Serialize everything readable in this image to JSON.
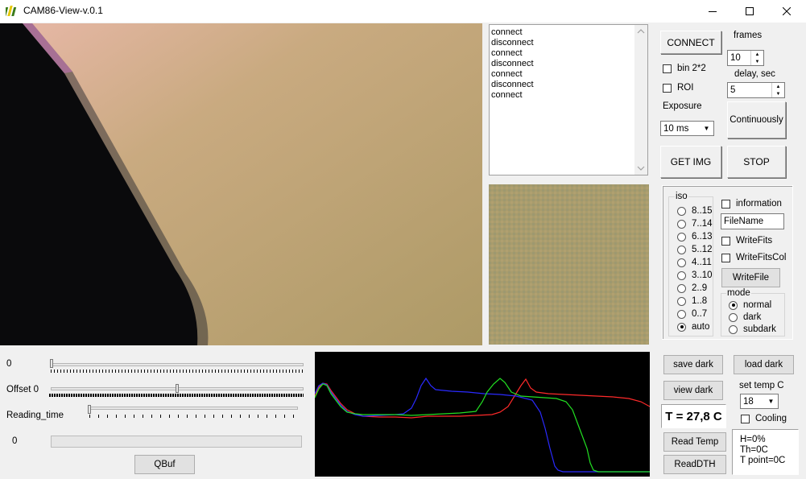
{
  "window": {
    "title": "CAM86-View-v.0.1"
  },
  "log": {
    "lines": [
      "connect",
      "disconnect",
      "connect",
      "disconnect",
      "connect",
      "disconnect",
      "connect"
    ]
  },
  "controls": {
    "connect_label": "CONNECT",
    "frames_label": "frames",
    "frames_value": "10",
    "bin_label": "bin 2*2",
    "roi_label": "ROI",
    "delay_label": "delay, sec",
    "delay_value": "5",
    "exposure_label": "Exposure",
    "exposure_value": "10 ms",
    "continuously_label": "Continuously",
    "get_img_label": "GET IMG",
    "stop_label": "STOP"
  },
  "iso": {
    "title": "iso",
    "options": [
      "8..15",
      "7..14",
      "6..13",
      "5..12",
      "4..11",
      "3..10",
      "2..9",
      "1..8",
      "0..7",
      "auto"
    ],
    "selected": "auto"
  },
  "file": {
    "information_label": "information",
    "filename_value": "FileName",
    "writefits_label": "WriteFits",
    "writefitscol_label": "WriteFitsCol",
    "writefile_label": "WriteFile"
  },
  "mode": {
    "title": "mode",
    "options": [
      "normal",
      "dark",
      "subdark"
    ],
    "selected": "normal"
  },
  "sliders": {
    "gain_value": "0",
    "offset_label": "Offset 0",
    "reading_time_label": "Reading_time",
    "progress_value": "0",
    "gain_pos": 0,
    "offset_pos": 0.5,
    "reading_time_pos": 0,
    "progress": 0
  },
  "qbuf_label": "QBuf",
  "dark": {
    "save_label": "save dark",
    "load_label": "load dark",
    "view_label": "view dark"
  },
  "temperature": {
    "reading": "T = 27,8 C",
    "set_label": "set temp C",
    "set_value": "18",
    "cooling_label": "Cooling",
    "read_temp_label": "Read Temp",
    "read_dth_label": "ReadDTH",
    "humidity": "H=0%",
    "th": "Th=0C",
    "t_point": "T point=0C"
  },
  "colors": {
    "red": "#ff2a2a",
    "green": "#22e022",
    "blue": "#2a2aff"
  }
}
